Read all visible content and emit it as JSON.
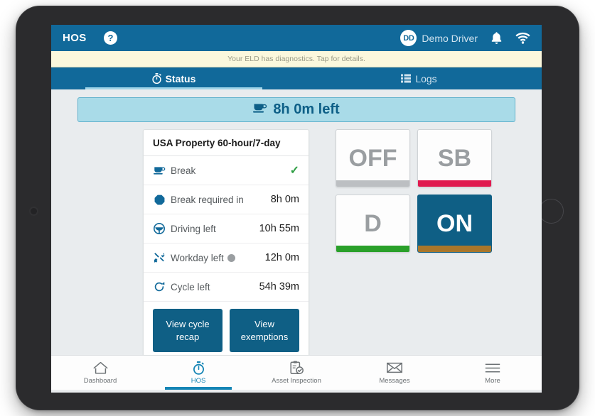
{
  "app": {
    "title": "HOS",
    "help_icon": "question-circle-icon"
  },
  "user": {
    "initials": "DD",
    "name": "Demo Driver",
    "bell_icon": "bell-icon",
    "wifi_icon": "wifi-icon"
  },
  "diagnostics": {
    "message": "Your ELD has diagnostics. Tap for details."
  },
  "tabs": [
    {
      "label": "Status",
      "icon": "stopwatch-icon",
      "active": true
    },
    {
      "label": "Logs",
      "icon": "list-icon",
      "active": false
    }
  ],
  "break_banner": {
    "icon": "coffee-cup-icon",
    "text": "8h 0m left"
  },
  "hos_card": {
    "title": "USA Property 60-hour/7-day",
    "rows": [
      {
        "icon": "coffee-cup-icon",
        "label": "Break",
        "value": "✓",
        "is_check": true
      },
      {
        "icon": "stop-sign-icon",
        "label": "Break required in",
        "value": "8h 0m"
      },
      {
        "icon": "steering-wheel-icon",
        "label": "Driving left",
        "value": "10h 55m"
      },
      {
        "icon": "tools-icon",
        "label": "Workday left",
        "value": "12h 0m",
        "has_dot": true
      },
      {
        "icon": "refresh-icon",
        "label": "Cycle left",
        "value": "54h 39m"
      }
    ],
    "buttons": [
      {
        "label": "View cycle recap"
      },
      {
        "label": "View exemptions"
      }
    ]
  },
  "duty_status": {
    "options": [
      {
        "label": "OFF",
        "bar_color": "#bcbfc2",
        "selected": false
      },
      {
        "label": "SB",
        "bar_color": "#e01a4f",
        "selected": false
      },
      {
        "label": "D",
        "bar_color": "#2aa02a",
        "selected": false
      },
      {
        "label": "ON",
        "bar_color": "#a9762a",
        "selected": true
      }
    ]
  },
  "bottom_nav": [
    {
      "label": "Dashboard",
      "icon": "home-icon",
      "active": false
    },
    {
      "label": "HOS",
      "icon": "stopwatch-icon",
      "active": true
    },
    {
      "label": "Asset Inspection",
      "icon": "clipboard-check-icon",
      "active": false
    },
    {
      "label": "Messages",
      "icon": "envelope-icon",
      "active": false
    },
    {
      "label": "More",
      "icon": "hamburger-icon",
      "active": false
    }
  ],
  "colors": {
    "brand_blue": "#11699a",
    "deep_blue": "#0f5f85",
    "banner_cyan": "#a9dbe8",
    "diag_yellow": "#fbf8dd",
    "screen_bg": "#e9ecee"
  }
}
